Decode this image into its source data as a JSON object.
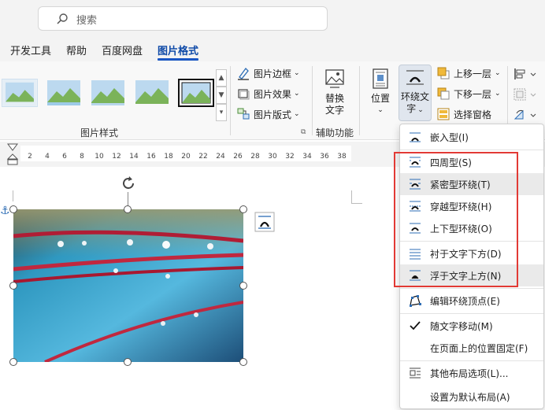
{
  "search": {
    "placeholder": "搜索"
  },
  "tabs": [
    {
      "label": "开发工具"
    },
    {
      "label": "帮助"
    },
    {
      "label": "百度网盘"
    },
    {
      "label": "图片格式"
    }
  ],
  "ribbon": {
    "picture_styles_label": "图片样式",
    "accessibility_label": "辅助功能",
    "picture_border": "图片边框",
    "picture_effects": "图片效果",
    "picture_layout": "图片版式",
    "alt_text_line1": "替换",
    "alt_text_line2": "文字",
    "position": "位置",
    "wrap_text_line1": "环绕文",
    "wrap_text_line2": "字",
    "bring_forward": "上移一层",
    "send_backward": "下移一层",
    "selection_pane": "选择窗格"
  },
  "ruler": {
    "ticks": [
      "2",
      "4",
      "6",
      "8",
      "10",
      "12",
      "14",
      "16",
      "18",
      "20",
      "22",
      "24",
      "26",
      "28",
      "30",
      "32",
      "34",
      "36",
      "38"
    ]
  },
  "wrap_menu": {
    "items": [
      {
        "label": "嵌入型(I)",
        "icon": "inline-wrap-icon"
      },
      {
        "label": "四周型(S)",
        "icon": "square-wrap-icon"
      },
      {
        "label": "紧密型环绕(T)",
        "icon": "tight-wrap-icon"
      },
      {
        "label": "穿越型环绕(H)",
        "icon": "through-wrap-icon"
      },
      {
        "label": "上下型环绕(O)",
        "icon": "topbottom-wrap-icon"
      },
      {
        "label": "衬于文字下方(D)",
        "icon": "behind-text-icon"
      },
      {
        "label": "浮于文字上方(N)",
        "icon": "infront-text-icon"
      },
      {
        "label": "编辑环绕顶点(E)",
        "icon": "edit-wrap-points-icon"
      },
      {
        "label": "随文字移动(M)",
        "icon": "checkmark-icon"
      },
      {
        "label": "在页面上的位置固定(F)",
        "icon": ""
      },
      {
        "label": "其他布局选项(L)...",
        "icon": "more-layout-icon"
      },
      {
        "label": "设置为默认布局(A)",
        "icon": ""
      }
    ]
  },
  "colors": {
    "accent": "#1a56c4",
    "highlight_box": "#e23a35"
  }
}
